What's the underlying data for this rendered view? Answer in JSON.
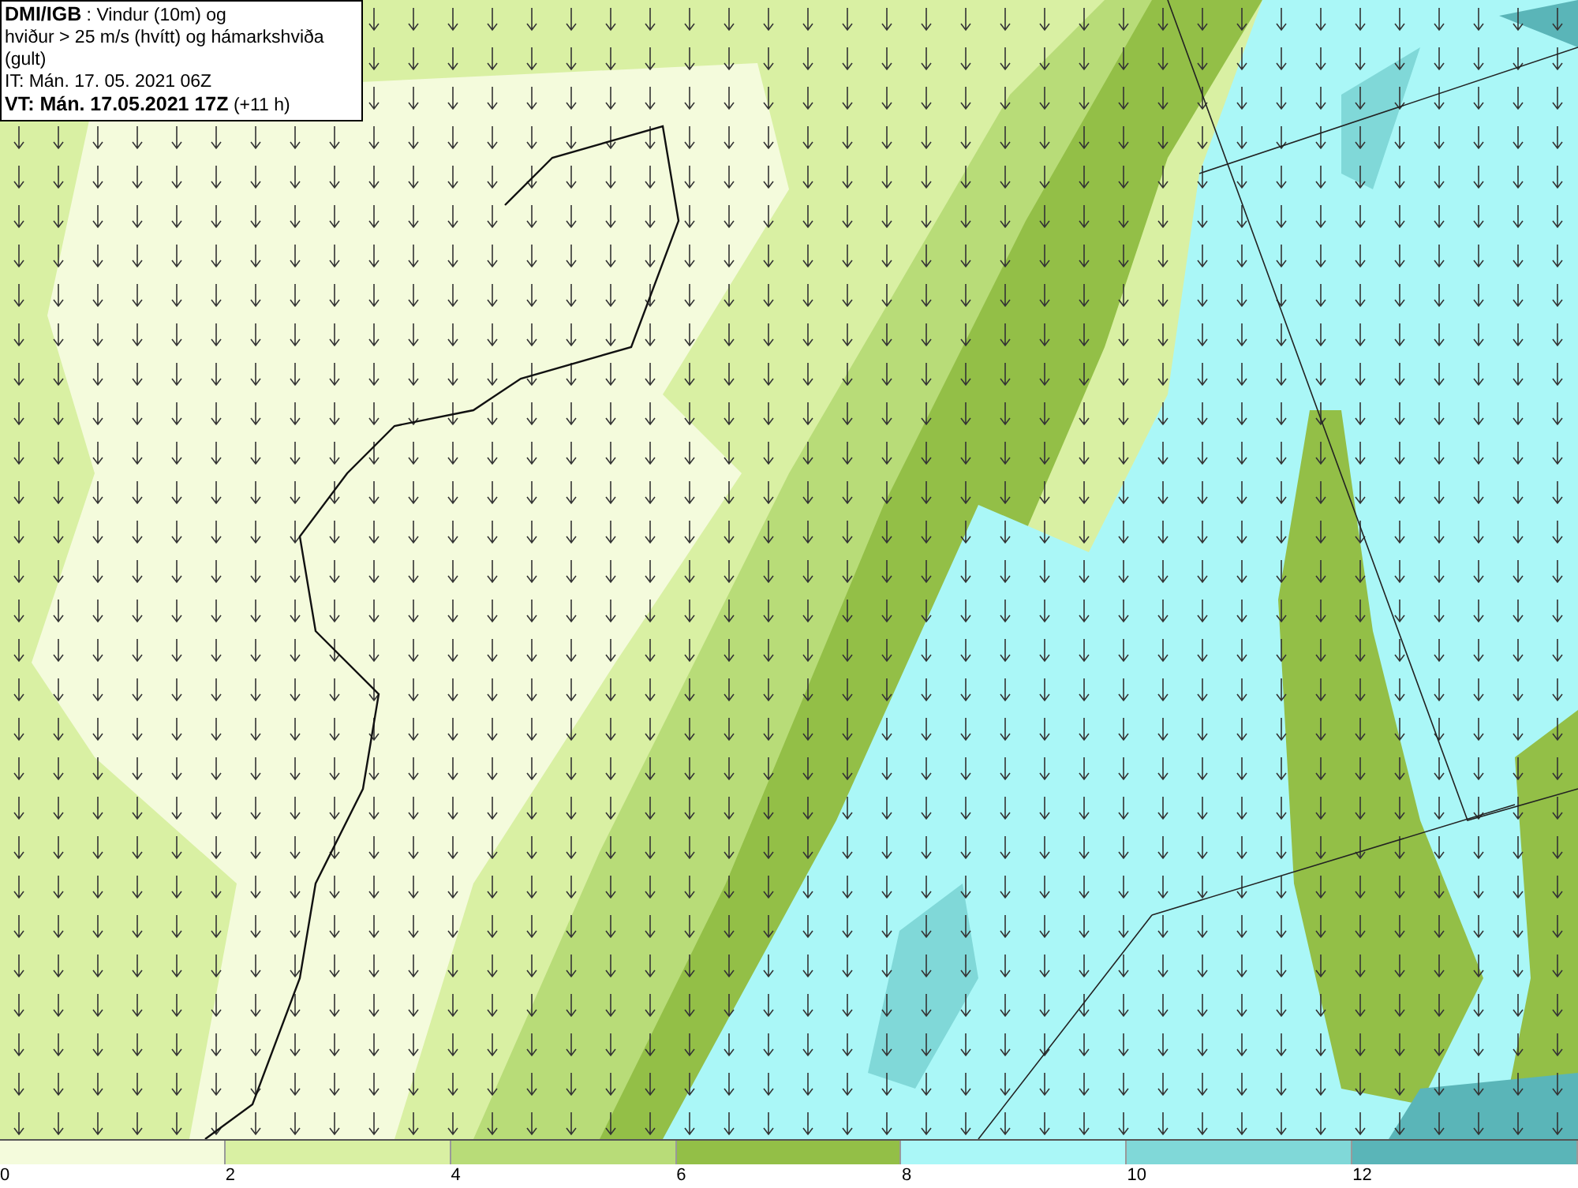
{
  "title_box": {
    "lines": [
      "**DMI/IGB** : Vindur (10m) og",
      "hviður > 25 m/s (hvítt) og hámarkshviða (gult)",
      "IT: Mán. 17. 05. 2021 06Z",
      "**VT: Mán. 17.05.2021 17Z** (+11 h)"
    ]
  },
  "legend": [
    {
      "label": "0",
      "color": "#f4fbdc"
    },
    {
      "label": "2",
      "color": "#d9f0a3"
    },
    {
      "label": "4",
      "color": "#b8dc78"
    },
    {
      "label": "6",
      "color": "#93bf47"
    },
    {
      "label": "8",
      "color": "#aaf7f7"
    },
    {
      "label": "10",
      "color": "#80d8d8"
    },
    {
      "label": "12",
      "color": "#5ab5b8"
    }
  ]
}
